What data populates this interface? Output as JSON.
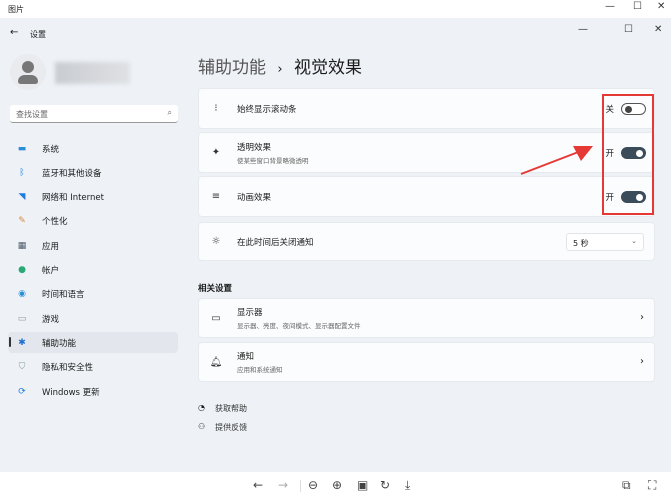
{
  "viewer": {
    "title": "图片"
  },
  "settings": {
    "title": "设置",
    "search_placeholder": "查找设置",
    "nav": [
      {
        "label": "系统",
        "icon": "system-icon",
        "color": "#2b8fd6"
      },
      {
        "label": "蓝牙和其他设备",
        "icon": "bluetooth-icon",
        "color": "#1e7be0"
      },
      {
        "label": "网络和 Internet",
        "icon": "wifi-icon",
        "color": "#1e7be0"
      },
      {
        "label": "个性化",
        "icon": "brush-icon",
        "color": "#d88a3a"
      },
      {
        "label": "应用",
        "icon": "apps-icon",
        "color": "#4a5a6a"
      },
      {
        "label": "帐户",
        "icon": "account-icon",
        "color": "#2aa876"
      },
      {
        "label": "时间和语言",
        "icon": "globe-clock-icon",
        "color": "#2b8fd6"
      },
      {
        "label": "游戏",
        "icon": "gamepad-icon",
        "color": "#8a96a3"
      },
      {
        "label": "辅助功能",
        "icon": "accessibility-icon",
        "color": "#1e6fd0",
        "selected": true
      },
      {
        "label": "隐私和安全性",
        "icon": "shield-icon",
        "color": "#8a96a3"
      },
      {
        "label": "Windows 更新",
        "icon": "update-icon",
        "color": "#1e7be0"
      }
    ],
    "breadcrumb": {
      "parent": "辅助功能",
      "sep": "›",
      "current": "视觉效果"
    },
    "options": [
      {
        "title": "始终显示滚动条",
        "subtitle": "",
        "state_label": "关",
        "on": false,
        "icon": "scrollbar-icon"
      },
      {
        "title": "透明效果",
        "subtitle": "使某些窗口背景略微透明",
        "state_label": "开",
        "on": true,
        "icon": "transparency-icon"
      },
      {
        "title": "动画效果",
        "subtitle": "",
        "state_label": "开",
        "on": true,
        "icon": "animation-icon"
      }
    ],
    "notify": {
      "title": "在此时间后关闭通知",
      "value": "5 秒"
    },
    "related": {
      "heading": "相关设置",
      "items": [
        {
          "title": "显示器",
          "subtitle": "显示器、亮度、夜间模式、显示器配置文件"
        },
        {
          "title": "通知",
          "subtitle": "应用和系统通知"
        }
      ]
    },
    "help": "获取帮助",
    "feedback": "提供反馈"
  },
  "annotation_color": "#e53935"
}
